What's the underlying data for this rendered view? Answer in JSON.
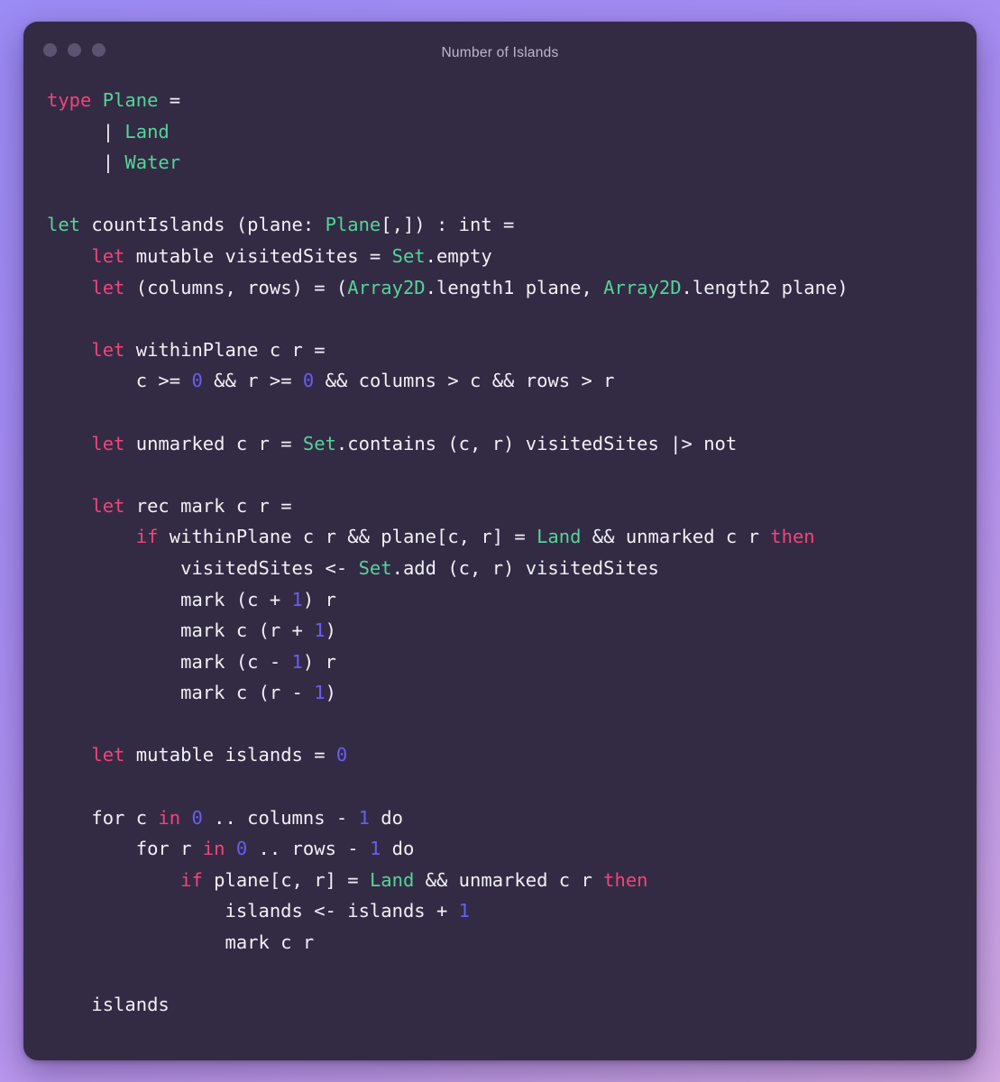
{
  "window": {
    "title": "Number of Islands",
    "traffic_lights": [
      {
        "name": "close-dot",
        "color": "#5b5470"
      },
      {
        "name": "minimize-dot",
        "color": "#5b5470"
      },
      {
        "name": "maximize-dot",
        "color": "#5b5470"
      }
    ]
  },
  "theme": {
    "page_background_start": "#9b8bf4",
    "page_background_end": "#d2a9e2",
    "panel_background": "#332b44",
    "default_text": "#f2f0f7",
    "title_text": "#bdb7cf",
    "keyword_pink": "#f2447c",
    "keyword_green": "#55d499",
    "type_green": "#55d499",
    "number_purple": "#6a5df0"
  },
  "code": {
    "language": "fsharp",
    "plain_text": "type Plane =\n     | Land\n     | Water\n\nlet countIslands (plane: Plane[,]) : int =\n    let mutable visitedSites = Set.empty\n    let (columns, rows) = (Array2D.length1 plane, Array2D.length2 plane)\n\n    let withinPlane c r =\n        c >= 0 && r >= 0 && columns > c && rows > r\n\n    let unmarked c r = Set.contains (c, r) visitedSites |> not\n\n    let rec mark c r =\n        if withinPlane c r && plane[c, r] = Land && unmarked c r then\n            visitedSites <- Set.add (c, r) visitedSites\n            mark (c + 1) r\n            mark c (r + 1)\n            mark (c - 1) r\n            mark c (r - 1)\n\n    let mutable islands = 0\n\n    for c in 0 .. columns - 1 do\n        for r in 0 .. rows - 1 do\n            if plane[c, r] = Land && unmarked c r then\n                islands <- islands + 1\n                mark c r\n\n    islands",
    "lines": [
      {
        "n": 1,
        "tokens": [
          {
            "t": "type",
            "c": "kw"
          },
          {
            "t": " ",
            "c": "pl"
          },
          {
            "t": "Plane",
            "c": "ty"
          },
          {
            "t": " =",
            "c": "pl"
          }
        ]
      },
      {
        "n": 2,
        "tokens": [
          {
            "t": "     | ",
            "c": "pl"
          },
          {
            "t": "Land",
            "c": "ty"
          }
        ]
      },
      {
        "n": 3,
        "tokens": [
          {
            "t": "     | ",
            "c": "pl"
          },
          {
            "t": "Water",
            "c": "ty"
          }
        ]
      },
      {
        "n": 4,
        "tokens": []
      },
      {
        "n": 5,
        "tokens": [
          {
            "t": "let",
            "c": "kw-top"
          },
          {
            "t": " countIslands (plane: ",
            "c": "pl"
          },
          {
            "t": "Plane",
            "c": "ty"
          },
          {
            "t": "[,]) : int =",
            "c": "pl"
          }
        ]
      },
      {
        "n": 6,
        "tokens": [
          {
            "t": "    ",
            "c": "pl"
          },
          {
            "t": "let",
            "c": "kw"
          },
          {
            "t": " mutable visitedSites = ",
            "c": "pl"
          },
          {
            "t": "Set",
            "c": "ty"
          },
          {
            "t": ".empty",
            "c": "pl"
          }
        ]
      },
      {
        "n": 7,
        "tokens": [
          {
            "t": "    ",
            "c": "pl"
          },
          {
            "t": "let",
            "c": "kw"
          },
          {
            "t": " (columns, rows) = (",
            "c": "pl"
          },
          {
            "t": "Array2D",
            "c": "ty"
          },
          {
            "t": ".length1 plane, ",
            "c": "pl"
          },
          {
            "t": "Array2D",
            "c": "ty"
          },
          {
            "t": ".length2 plane)",
            "c": "pl"
          }
        ]
      },
      {
        "n": 8,
        "tokens": []
      },
      {
        "n": 9,
        "tokens": [
          {
            "t": "    ",
            "c": "pl"
          },
          {
            "t": "let",
            "c": "kw"
          },
          {
            "t": " withinPlane c r =",
            "c": "pl"
          }
        ]
      },
      {
        "n": 10,
        "tokens": [
          {
            "t": "        c >= ",
            "c": "pl"
          },
          {
            "t": "0",
            "c": "num"
          },
          {
            "t": " && r >= ",
            "c": "pl"
          },
          {
            "t": "0",
            "c": "num"
          },
          {
            "t": " && columns > c && rows > r",
            "c": "pl"
          }
        ]
      },
      {
        "n": 11,
        "tokens": []
      },
      {
        "n": 12,
        "tokens": [
          {
            "t": "    ",
            "c": "pl"
          },
          {
            "t": "let",
            "c": "kw"
          },
          {
            "t": " unmarked c r = ",
            "c": "pl"
          },
          {
            "t": "Set",
            "c": "ty"
          },
          {
            "t": ".contains (c, r) visitedSites |> not",
            "c": "pl"
          }
        ]
      },
      {
        "n": 13,
        "tokens": []
      },
      {
        "n": 14,
        "tokens": [
          {
            "t": "    ",
            "c": "pl"
          },
          {
            "t": "let",
            "c": "kw"
          },
          {
            "t": " rec mark c r =",
            "c": "pl"
          }
        ]
      },
      {
        "n": 15,
        "tokens": [
          {
            "t": "        ",
            "c": "pl"
          },
          {
            "t": "if",
            "c": "kw"
          },
          {
            "t": " withinPlane c r && plane[c, r] = ",
            "c": "pl"
          },
          {
            "t": "Land",
            "c": "ty"
          },
          {
            "t": " && unmarked c r ",
            "c": "pl"
          },
          {
            "t": "then",
            "c": "kw"
          }
        ]
      },
      {
        "n": 16,
        "tokens": [
          {
            "t": "            visitedSites <- ",
            "c": "pl"
          },
          {
            "t": "Set",
            "c": "ty"
          },
          {
            "t": ".add (c, r) visitedSites",
            "c": "pl"
          }
        ]
      },
      {
        "n": 17,
        "tokens": [
          {
            "t": "            mark (c + ",
            "c": "pl"
          },
          {
            "t": "1",
            "c": "num"
          },
          {
            "t": ") r",
            "c": "pl"
          }
        ]
      },
      {
        "n": 18,
        "tokens": [
          {
            "t": "            mark c (r + ",
            "c": "pl"
          },
          {
            "t": "1",
            "c": "num"
          },
          {
            "t": ")",
            "c": "pl"
          }
        ]
      },
      {
        "n": 19,
        "tokens": [
          {
            "t": "            mark (c - ",
            "c": "pl"
          },
          {
            "t": "1",
            "c": "num"
          },
          {
            "t": ") r",
            "c": "pl"
          }
        ]
      },
      {
        "n": 20,
        "tokens": [
          {
            "t": "            mark c (r - ",
            "c": "pl"
          },
          {
            "t": "1",
            "c": "num"
          },
          {
            "t": ")",
            "c": "pl"
          }
        ]
      },
      {
        "n": 21,
        "tokens": []
      },
      {
        "n": 22,
        "tokens": [
          {
            "t": "    ",
            "c": "pl"
          },
          {
            "t": "let",
            "c": "kw"
          },
          {
            "t": " mutable islands = ",
            "c": "pl"
          },
          {
            "t": "0",
            "c": "num"
          }
        ]
      },
      {
        "n": 23,
        "tokens": []
      },
      {
        "n": 24,
        "tokens": [
          {
            "t": "    for c ",
            "c": "pl"
          },
          {
            "t": "in",
            "c": "kw"
          },
          {
            "t": " ",
            "c": "pl"
          },
          {
            "t": "0",
            "c": "num"
          },
          {
            "t": " .. columns - ",
            "c": "pl"
          },
          {
            "t": "1",
            "c": "num"
          },
          {
            "t": " do",
            "c": "pl"
          }
        ]
      },
      {
        "n": 25,
        "tokens": [
          {
            "t": "        for r ",
            "c": "pl"
          },
          {
            "t": "in",
            "c": "kw"
          },
          {
            "t": " ",
            "c": "pl"
          },
          {
            "t": "0",
            "c": "num"
          },
          {
            "t": " .. rows - ",
            "c": "pl"
          },
          {
            "t": "1",
            "c": "num"
          },
          {
            "t": " do",
            "c": "pl"
          }
        ]
      },
      {
        "n": 26,
        "tokens": [
          {
            "t": "            ",
            "c": "pl"
          },
          {
            "t": "if",
            "c": "kw"
          },
          {
            "t": " plane[c, r] = ",
            "c": "pl"
          },
          {
            "t": "Land",
            "c": "ty"
          },
          {
            "t": " && unmarked c r ",
            "c": "pl"
          },
          {
            "t": "then",
            "c": "kw"
          }
        ]
      },
      {
        "n": 27,
        "tokens": [
          {
            "t": "                islands <- islands + ",
            "c": "pl"
          },
          {
            "t": "1",
            "c": "num"
          }
        ]
      },
      {
        "n": 28,
        "tokens": [
          {
            "t": "                mark c r",
            "c": "pl"
          }
        ]
      },
      {
        "n": 29,
        "tokens": []
      },
      {
        "n": 30,
        "tokens": [
          {
            "t": "    islands",
            "c": "pl"
          }
        ]
      }
    ]
  }
}
